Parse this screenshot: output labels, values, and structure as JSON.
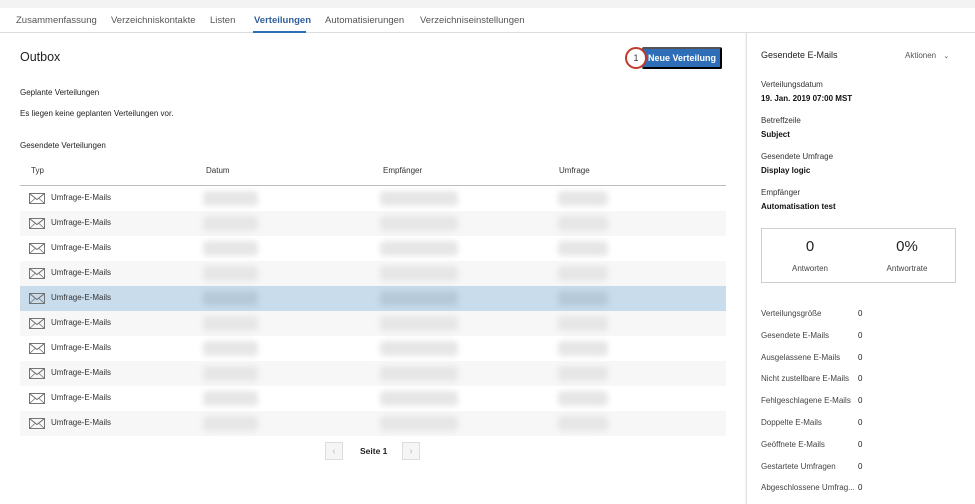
{
  "tabs": [
    {
      "label": "Zusammenfassung",
      "active": false
    },
    {
      "label": "Verzeichniskontakte",
      "active": false
    },
    {
      "label": "Listen",
      "active": false
    },
    {
      "label": "Verteilungen",
      "active": true
    },
    {
      "label": "Automatisierungen",
      "active": false
    },
    {
      "label": "Verzeichniseinstellungen",
      "active": false
    }
  ],
  "main": {
    "title": "Outbox",
    "new_button": "Neue Verteilung",
    "step_badge": "1",
    "scheduled_heading": "Geplante Verteilungen",
    "scheduled_empty": "Es liegen keine geplanten Verteilungen vor.",
    "sent_heading": "Gesendete Verteilungen",
    "columns": [
      "Typ",
      "Datum",
      "Empfänger",
      "Umfrage"
    ],
    "rows": [
      {
        "type": "Umfrage-E-Mails",
        "selected": false
      },
      {
        "type": "Umfrage-E-Mails",
        "selected": false
      },
      {
        "type": "Umfrage-E-Mails",
        "selected": false
      },
      {
        "type": "Umfrage-E-Mails",
        "selected": false
      },
      {
        "type": "Umfrage-E-Mails",
        "selected": true
      },
      {
        "type": "Umfrage-E-Mails",
        "selected": false
      },
      {
        "type": "Umfrage-E-Mails",
        "selected": false
      },
      {
        "type": "Umfrage-E-Mails",
        "selected": false
      },
      {
        "type": "Umfrage-E-Mails",
        "selected": false
      },
      {
        "type": "Umfrage-E-Mails",
        "selected": false
      }
    ],
    "pager": {
      "prev": "‹",
      "label": "Seite 1",
      "next": "›"
    }
  },
  "side": {
    "heading": "Gesendete E-Mails",
    "actions": "Aktionen",
    "date_label": "Verteilungsdatum",
    "date_value": "19. Jan. 2019 07:00 MST",
    "subject_label": "Betreffzeile",
    "subject_value": "Subject",
    "survey_label": "Gesendete Umfrage",
    "survey_value": "Display logic",
    "recipients_label": "Empfänger",
    "recipients_value": "Automatisation test",
    "responses_value": "0",
    "responses_label": "Antworten",
    "rate_value": "0%",
    "rate_label": "Antwortrate",
    "metrics": [
      {
        "label": "Verteilungsgröße",
        "value": "0"
      },
      {
        "label": "Gesendete E-Mails",
        "value": "0"
      },
      {
        "label": "Ausgelassene E-Mails",
        "value": "0"
      },
      {
        "label": "Nicht zustellbare E-Mails",
        "value": "0"
      },
      {
        "label": "Fehlgeschlagene E-Mails",
        "value": "0"
      },
      {
        "label": "Doppelte E-Mails",
        "value": "0"
      },
      {
        "label": "Geöffnete E-Mails",
        "value": "0"
      },
      {
        "label": "Gestartete Umfragen",
        "value": "0"
      },
      {
        "label": "Abgeschlossene Umfrag...",
        "value": "0"
      }
    ]
  },
  "colors": {
    "accent": "#2e6db7",
    "selected_row": "#c8dcec",
    "badge_ring": "#c0392b"
  }
}
